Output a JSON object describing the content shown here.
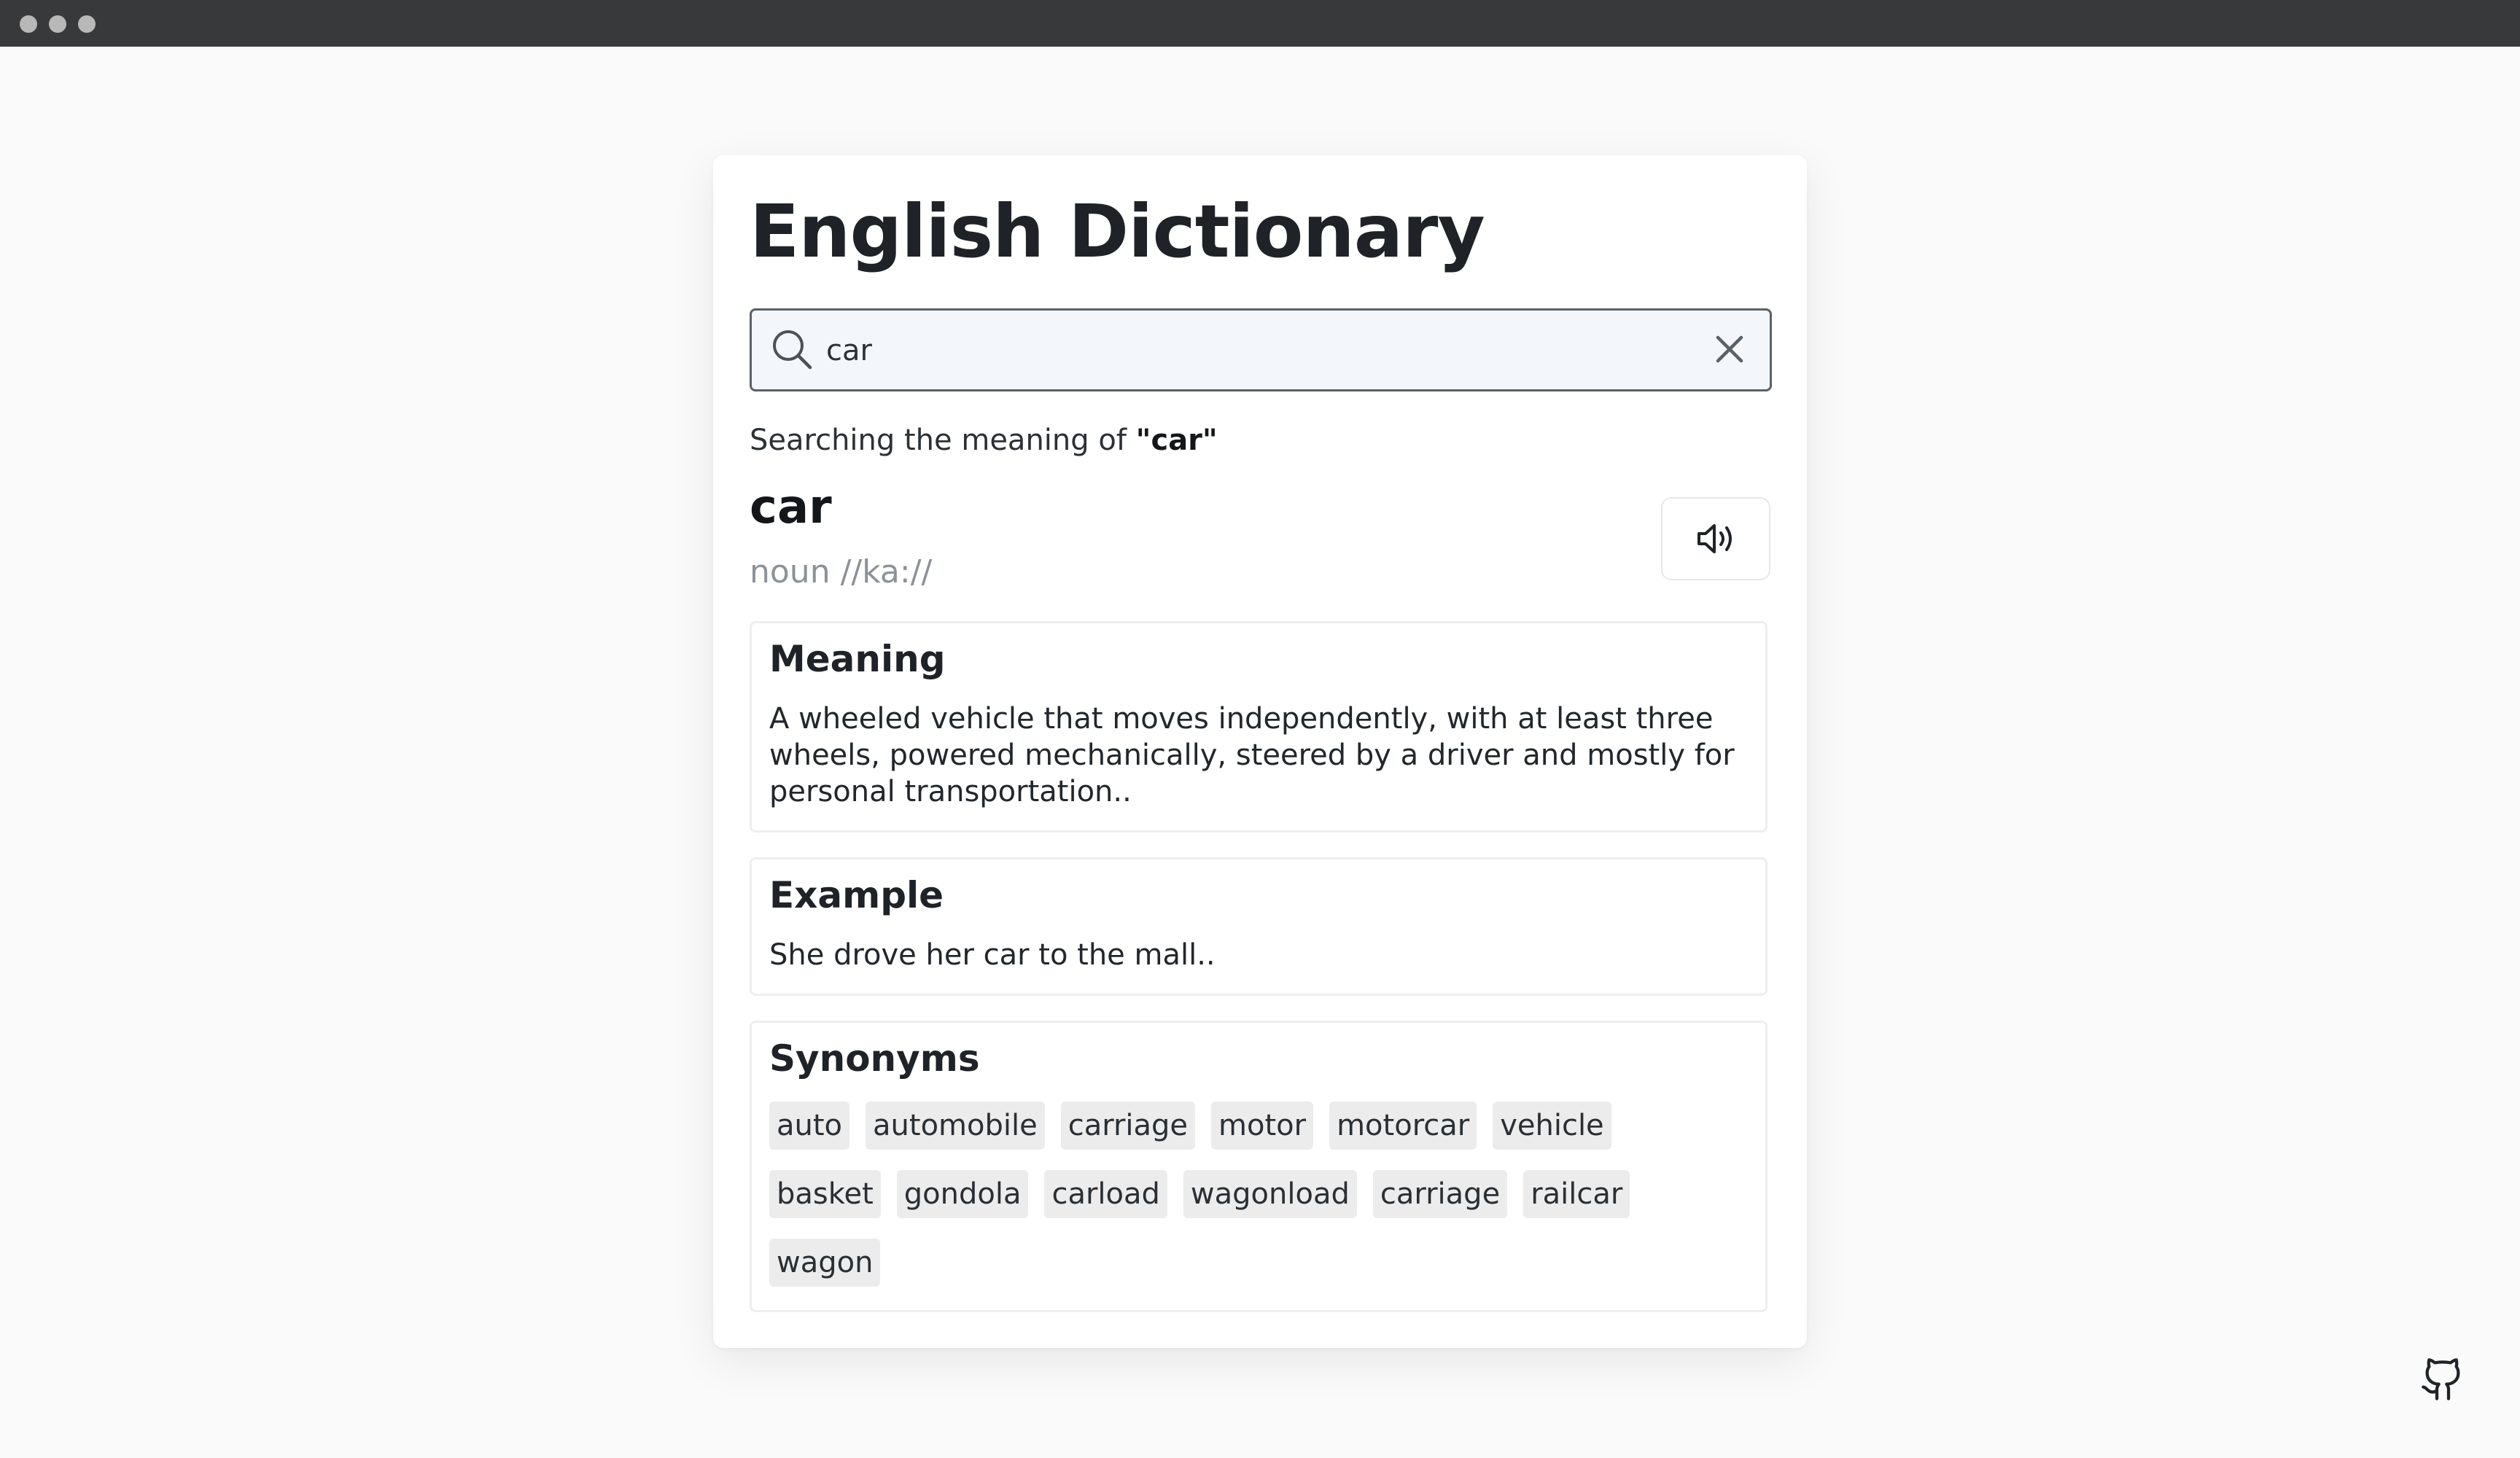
{
  "app": {
    "title": "English Dictionary"
  },
  "search": {
    "value": "car",
    "placeholder": "Search a word"
  },
  "status": {
    "prefix": "Searching the meaning of ",
    "query": "\"car\""
  },
  "entry": {
    "word": "car",
    "phonetic": "noun //ka://",
    "meaning": {
      "heading": "Meaning",
      "text": "A wheeled vehicle that moves independently, with at least three wheels, powered mechanically, steered by a driver and mostly for personal transportation.."
    },
    "example": {
      "heading": "Example",
      "text": "She drove her car to the mall.."
    },
    "synonyms": {
      "heading": "Synonyms",
      "items": [
        "auto",
        "automobile",
        "carriage",
        "motor",
        "motorcar",
        "vehicle",
        "basket",
        "gondola",
        "carload",
        "wagonload",
        "carriage",
        "railcar",
        "wagon"
      ]
    }
  },
  "icons": {
    "search": "search-icon",
    "clear": "close-icon",
    "sound": "speaker-icon",
    "footer": "github-icon"
  },
  "colors": {
    "background": "#fafafa",
    "titlebar": "#38393b",
    "search_bg": "#f3f7fb",
    "chip_bg": "#ececec",
    "muted_text": "#8d9298"
  }
}
